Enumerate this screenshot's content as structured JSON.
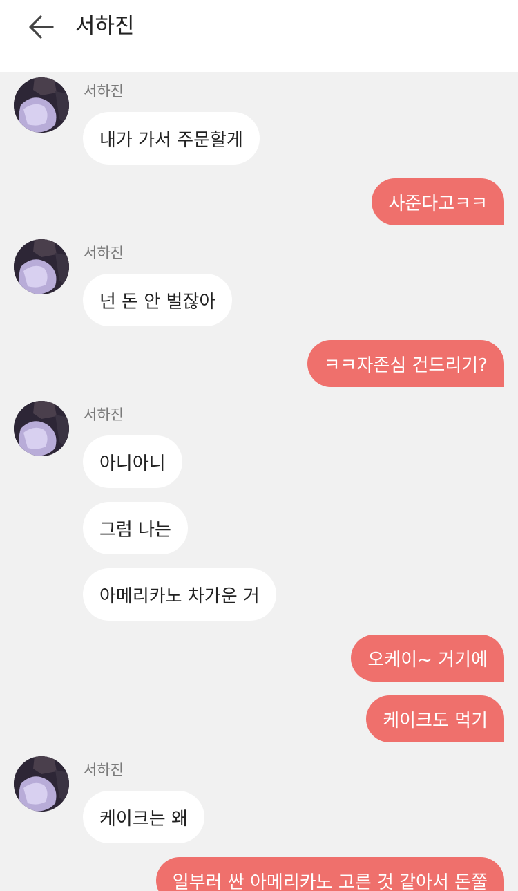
{
  "header": {
    "title": "서하진",
    "back_icon": "arrow-left-icon"
  },
  "colors": {
    "outgoing_bubble": "#ef706c",
    "incoming_bubble": "#ffffff",
    "background": "#f1f1f1"
  },
  "messages": [
    {
      "side": "in",
      "sender": "서하진",
      "text": "내가 가서 주문할게"
    },
    {
      "side": "out",
      "text": "사준다고ㅋㅋ"
    },
    {
      "side": "in",
      "sender": "서하진",
      "text": "넌 돈 안 벌잖아"
    },
    {
      "side": "out",
      "text": "ㅋㅋ자존심 건드리기?"
    },
    {
      "side": "in",
      "sender": "서하진",
      "text": "아니아니"
    },
    {
      "side": "in",
      "text": "그럼 나는"
    },
    {
      "side": "in",
      "text": "아메리카노 차가운 거"
    },
    {
      "side": "out",
      "text": "오케이~ 거기에"
    },
    {
      "side": "out",
      "text": "케이크도 먹기"
    },
    {
      "side": "in",
      "sender": "서하진",
      "text": "케이크는 왜"
    },
    {
      "side": "out",
      "text": "일부러 싼 아메리카노 고른 것 같아서 돈쭐"
    }
  ]
}
